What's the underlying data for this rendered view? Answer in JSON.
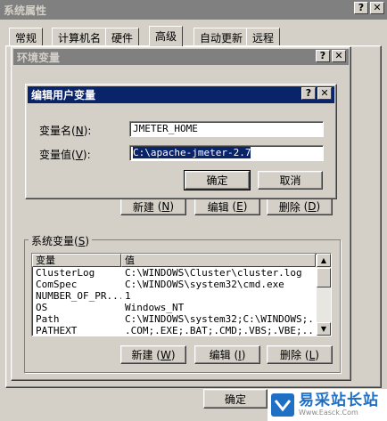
{
  "sysprops": {
    "title": "系统属性",
    "help_glyph": "?",
    "close_glyph": "✕",
    "tabs": [
      {
        "label": "常规"
      },
      {
        "label": "计算机名"
      },
      {
        "label": "硬件"
      },
      {
        "label": "高级"
      },
      {
        "label": "自动更新"
      },
      {
        "label": "远程"
      }
    ],
    "ok_label": "确定"
  },
  "envvars": {
    "title": "环境变量",
    "user_buttons": {
      "new": "新建",
      "new_key": "N",
      "edit": "编辑",
      "edit_key": "E",
      "delete": "删除",
      "delete_key": "D"
    },
    "system_group_label": "系统变量",
    "system_group_key": "S",
    "columns": {
      "var": "变量",
      "value": "值"
    },
    "rows": [
      {
        "var": "ClusterLog",
        "value": "C:\\WINDOWS\\Cluster\\cluster.log"
      },
      {
        "var": "ComSpec",
        "value": "C:\\WINDOWS\\system32\\cmd.exe"
      },
      {
        "var": "NUMBER_OF_PR...",
        "value": "1"
      },
      {
        "var": "OS",
        "value": "Windows_NT"
      },
      {
        "var": "Path",
        "value": "C:\\WINDOWS\\system32;C:\\WINDOWS;..."
      },
      {
        "var": "PATHEXT",
        "value": ".COM;.EXE;.BAT;.CMD;.VBS;.VBE;..."
      }
    ],
    "system_buttons": {
      "new": "新建",
      "new_key": "W",
      "edit": "编辑",
      "edit_key": "I",
      "delete": "删除",
      "delete_key": "L"
    }
  },
  "edituser": {
    "title": "编辑用户变量",
    "name_label": "变量名",
    "name_key": "N",
    "name_value": "JMETER_HOME",
    "value_label": "变量值",
    "value_key": "V",
    "value_value": "C:\\apache-jmeter-2.7",
    "ok_label": "确定",
    "cancel_label": "取消"
  },
  "watermark": {
    "brand": "易采站长站",
    "url": "Www.Easck.Com"
  }
}
